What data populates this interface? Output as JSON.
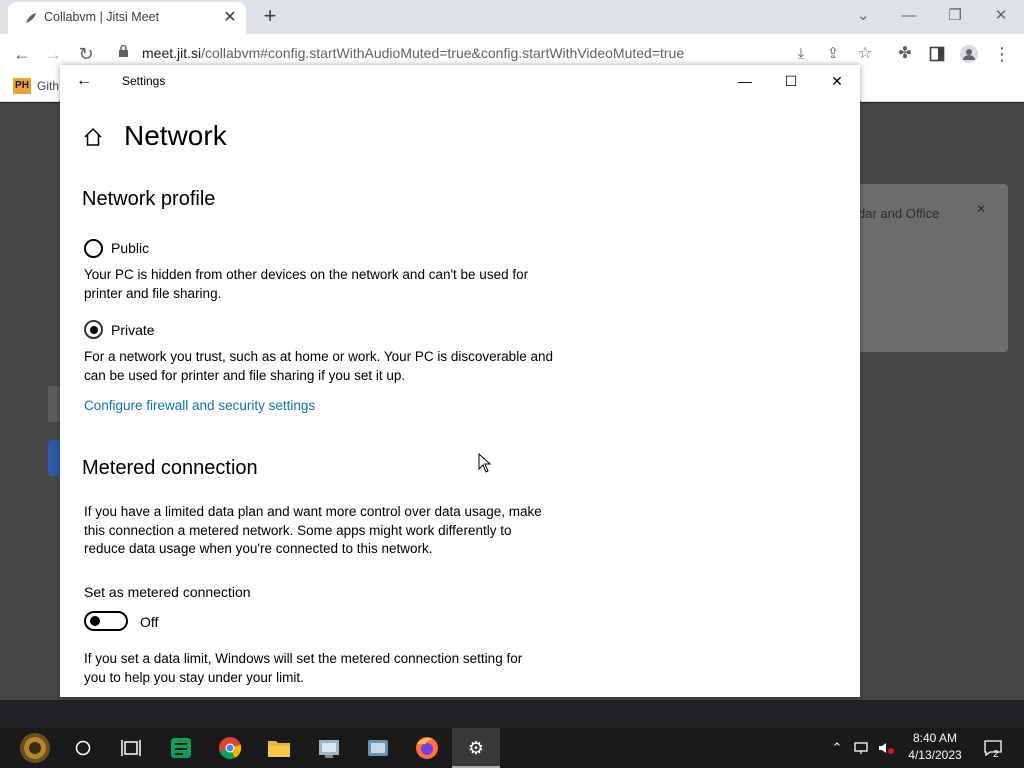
{
  "browser": {
    "tab_title": "Collabvm | Jitsi Meet",
    "url_domain": "meet.jit.si",
    "url_rest": "/collabvm#config.startWithAudioMuted=true&config.startWithVideoMuted=true",
    "bookmark_icon_text": "PH",
    "bookmark_label": "Gith"
  },
  "background_page": {
    "dialog_text": "dar and Office"
  },
  "settings": {
    "window_title": "Settings",
    "page_title": "Network",
    "network_profile": {
      "heading": "Network profile",
      "public_label": "Public",
      "public_desc": "Your PC is hidden from other devices on the network and can't be used for printer and file sharing.",
      "private_label": "Private",
      "private_desc": "For a network you trust, such as at home or work. Your PC is discoverable and can be used for printer and file sharing if you set it up.",
      "selected": "Private",
      "firewall_link": "Configure firewall and security settings"
    },
    "metered": {
      "heading": "Metered connection",
      "desc": "If you have a limited data plan and want more control over data usage, make this connection a metered network. Some apps might work differently to reduce data usage when you're connected to this network.",
      "toggle_caption": "Set as metered connection",
      "toggle_state": "Off",
      "limit_desc": "If you set a data limit, Windows will set the metered connection setting for you to help you stay under your limit."
    }
  },
  "taskbar": {
    "time": "8:40 AM",
    "date": "4/13/2023",
    "notification_count": "2"
  },
  "colors": {
    "link": "#0f73a8",
    "taskbar": "#1a1a1a",
    "chrome_tabstrip": "#dee1e6"
  }
}
